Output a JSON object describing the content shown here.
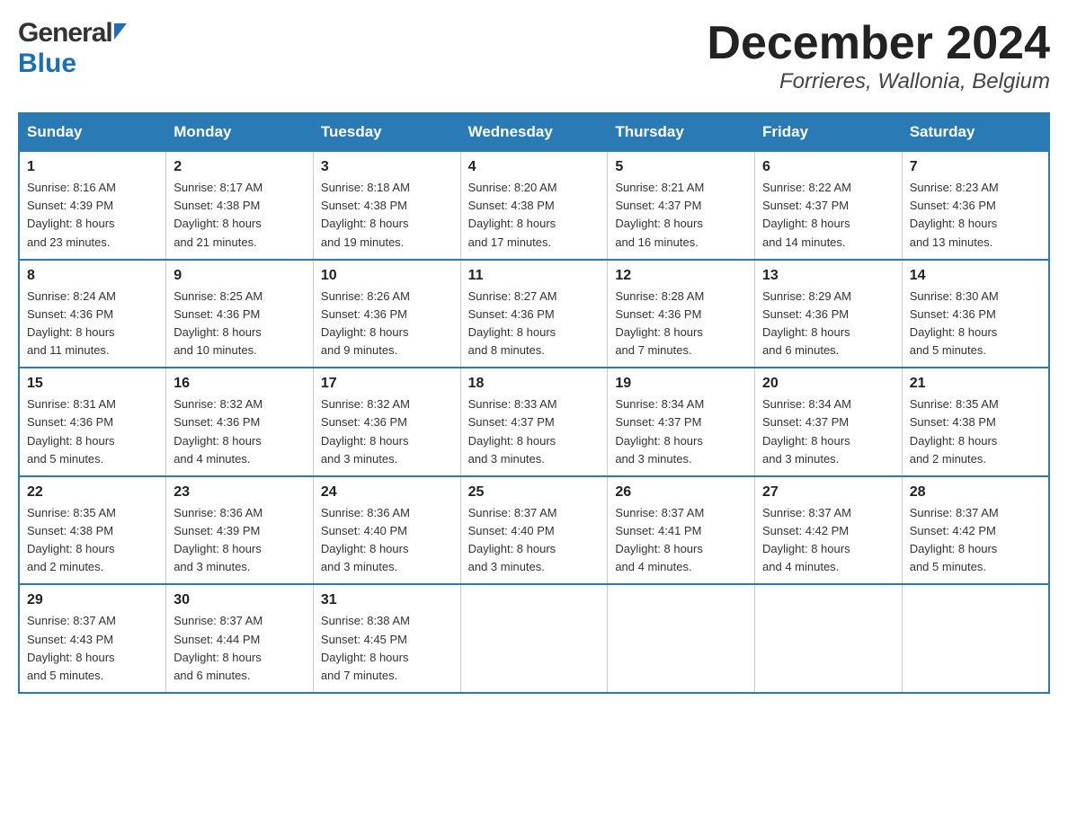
{
  "header": {
    "logo_general": "General",
    "logo_blue": "Blue",
    "month_title": "December 2024",
    "location": "Forrieres, Wallonia, Belgium"
  },
  "days_of_week": [
    "Sunday",
    "Monday",
    "Tuesday",
    "Wednesday",
    "Thursday",
    "Friday",
    "Saturday"
  ],
  "weeks": [
    [
      {
        "day": 1,
        "sunrise": "8:16 AM",
        "sunset": "4:39 PM",
        "daylight": "8 hours and 23 minutes."
      },
      {
        "day": 2,
        "sunrise": "8:17 AM",
        "sunset": "4:38 PM",
        "daylight": "8 hours and 21 minutes."
      },
      {
        "day": 3,
        "sunrise": "8:18 AM",
        "sunset": "4:38 PM",
        "daylight": "8 hours and 19 minutes."
      },
      {
        "day": 4,
        "sunrise": "8:20 AM",
        "sunset": "4:38 PM",
        "daylight": "8 hours and 17 minutes."
      },
      {
        "day": 5,
        "sunrise": "8:21 AM",
        "sunset": "4:37 PM",
        "daylight": "8 hours and 16 minutes."
      },
      {
        "day": 6,
        "sunrise": "8:22 AM",
        "sunset": "4:37 PM",
        "daylight": "8 hours and 14 minutes."
      },
      {
        "day": 7,
        "sunrise": "8:23 AM",
        "sunset": "4:36 PM",
        "daylight": "8 hours and 13 minutes."
      }
    ],
    [
      {
        "day": 8,
        "sunrise": "8:24 AM",
        "sunset": "4:36 PM",
        "daylight": "8 hours and 11 minutes."
      },
      {
        "day": 9,
        "sunrise": "8:25 AM",
        "sunset": "4:36 PM",
        "daylight": "8 hours and 10 minutes."
      },
      {
        "day": 10,
        "sunrise": "8:26 AM",
        "sunset": "4:36 PM",
        "daylight": "8 hours and 9 minutes."
      },
      {
        "day": 11,
        "sunrise": "8:27 AM",
        "sunset": "4:36 PM",
        "daylight": "8 hours and 8 minutes."
      },
      {
        "day": 12,
        "sunrise": "8:28 AM",
        "sunset": "4:36 PM",
        "daylight": "8 hours and 7 minutes."
      },
      {
        "day": 13,
        "sunrise": "8:29 AM",
        "sunset": "4:36 PM",
        "daylight": "8 hours and 6 minutes."
      },
      {
        "day": 14,
        "sunrise": "8:30 AM",
        "sunset": "4:36 PM",
        "daylight": "8 hours and 5 minutes."
      }
    ],
    [
      {
        "day": 15,
        "sunrise": "8:31 AM",
        "sunset": "4:36 PM",
        "daylight": "8 hours and 5 minutes."
      },
      {
        "day": 16,
        "sunrise": "8:32 AM",
        "sunset": "4:36 PM",
        "daylight": "8 hours and 4 minutes."
      },
      {
        "day": 17,
        "sunrise": "8:32 AM",
        "sunset": "4:36 PM",
        "daylight": "8 hours and 3 minutes."
      },
      {
        "day": 18,
        "sunrise": "8:33 AM",
        "sunset": "4:37 PM",
        "daylight": "8 hours and 3 minutes."
      },
      {
        "day": 19,
        "sunrise": "8:34 AM",
        "sunset": "4:37 PM",
        "daylight": "8 hours and 3 minutes."
      },
      {
        "day": 20,
        "sunrise": "8:34 AM",
        "sunset": "4:37 PM",
        "daylight": "8 hours and 3 minutes."
      },
      {
        "day": 21,
        "sunrise": "8:35 AM",
        "sunset": "4:38 PM",
        "daylight": "8 hours and 2 minutes."
      }
    ],
    [
      {
        "day": 22,
        "sunrise": "8:35 AM",
        "sunset": "4:38 PM",
        "daylight": "8 hours and 2 minutes."
      },
      {
        "day": 23,
        "sunrise": "8:36 AM",
        "sunset": "4:39 PM",
        "daylight": "8 hours and 3 minutes."
      },
      {
        "day": 24,
        "sunrise": "8:36 AM",
        "sunset": "4:40 PM",
        "daylight": "8 hours and 3 minutes."
      },
      {
        "day": 25,
        "sunrise": "8:37 AM",
        "sunset": "4:40 PM",
        "daylight": "8 hours and 3 minutes."
      },
      {
        "day": 26,
        "sunrise": "8:37 AM",
        "sunset": "4:41 PM",
        "daylight": "8 hours and 4 minutes."
      },
      {
        "day": 27,
        "sunrise": "8:37 AM",
        "sunset": "4:42 PM",
        "daylight": "8 hours and 4 minutes."
      },
      {
        "day": 28,
        "sunrise": "8:37 AM",
        "sunset": "4:42 PM",
        "daylight": "8 hours and 5 minutes."
      }
    ],
    [
      {
        "day": 29,
        "sunrise": "8:37 AM",
        "sunset": "4:43 PM",
        "daylight": "8 hours and 5 minutes."
      },
      {
        "day": 30,
        "sunrise": "8:37 AM",
        "sunset": "4:44 PM",
        "daylight": "8 hours and 6 minutes."
      },
      {
        "day": 31,
        "sunrise": "8:38 AM",
        "sunset": "4:45 PM",
        "daylight": "8 hours and 7 minutes."
      },
      null,
      null,
      null,
      null
    ]
  ],
  "labels": {
    "sunrise": "Sunrise:",
    "sunset": "Sunset:",
    "daylight": "Daylight:"
  }
}
